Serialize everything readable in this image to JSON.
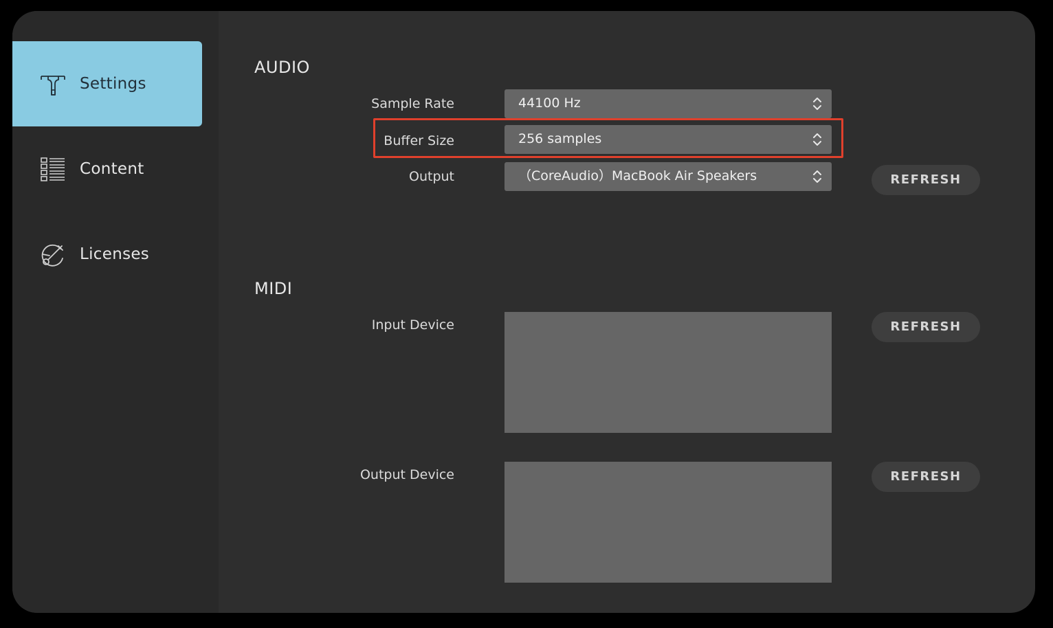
{
  "sidebar": {
    "items": [
      {
        "label": "Settings",
        "icon": "wrench-icon",
        "active": true
      },
      {
        "label": "Content",
        "icon": "list-icon",
        "active": false
      },
      {
        "label": "Licenses",
        "icon": "license-icon",
        "active": false
      }
    ]
  },
  "audio": {
    "title": "AUDIO",
    "sample_rate": {
      "label": "Sample Rate",
      "value": "44100 Hz"
    },
    "buffer_size": {
      "label": "Buffer Size",
      "value": "256 samples"
    },
    "output": {
      "label": "Output",
      "value": "（CoreAudio）MacBook Air Speakers"
    },
    "refresh_label": "REFRESH"
  },
  "midi": {
    "title": "MIDI",
    "input_device": {
      "label": "Input Device",
      "refresh_label": "REFRESH"
    },
    "output_device": {
      "label": "Output Device",
      "refresh_label": "REFRESH"
    }
  },
  "colors": {
    "accent": "#89cbe2",
    "highlight_border": "#e0402c",
    "background": "#2e2e2e",
    "sidebar": "#292929",
    "control": "#666666"
  }
}
